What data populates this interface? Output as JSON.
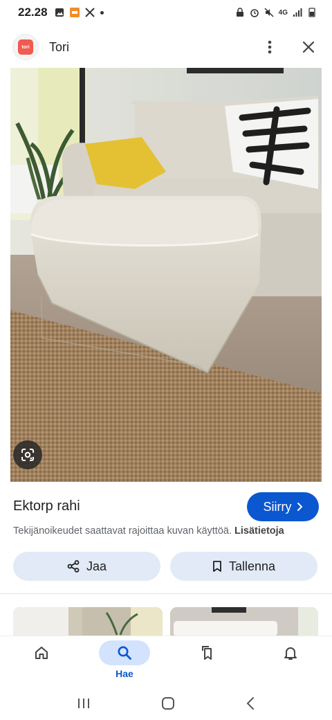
{
  "status_bar": {
    "time": "22.28",
    "network": "4G"
  },
  "source": {
    "logo_text": "tori",
    "name": "Tori"
  },
  "result": {
    "title": "Ektorp rahi",
    "visit_label": "Siirry",
    "copyright_text": "Tekijänoikeudet saattavat rajoittaa kuvan käyttöä.",
    "copyright_link": "Lisätietoja",
    "share_label": "Jaa",
    "save_label": "Tallenna"
  },
  "bottom_nav": {
    "items": [
      {
        "icon": "home-icon",
        "label": ""
      },
      {
        "icon": "search-icon",
        "label": "Hae"
      },
      {
        "icon": "collections-icon",
        "label": ""
      },
      {
        "icon": "notifications-icon",
        "label": ""
      }
    ]
  },
  "colors": {
    "accent": "#0b57d0",
    "button_bg": "#e2eaf7",
    "nav_active_bg": "#d3e3fd",
    "tori_brand": "#f05a4f"
  }
}
